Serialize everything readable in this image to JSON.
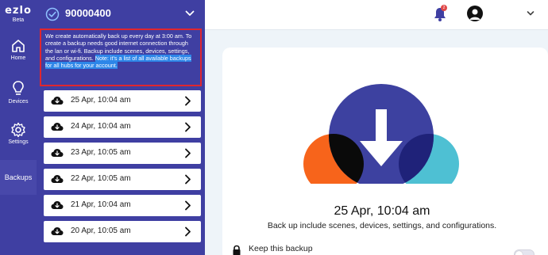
{
  "app": {
    "logo_text": "ezlo",
    "logo_badge": "Beta"
  },
  "nav": {
    "items": [
      {
        "label": "Home",
        "icon": "home-icon"
      },
      {
        "label": "Devices",
        "icon": "lightbulb-icon"
      },
      {
        "label": "Settings",
        "icon": "gear-icon"
      }
    ],
    "active": {
      "label": "Backups"
    }
  },
  "hub": {
    "id": "90000400",
    "status_icon": "check-circle-icon"
  },
  "info": {
    "text": "We create automatically back up every day at 3:00 am. To create a backup needs good internet connection through the lan or wi-fi. Backup include scenes, devices, settings, and configurations.",
    "note": "Note: it's a list of all available backups for all hubs for your account."
  },
  "backups": [
    {
      "date": "25 Apr, 10:04 am"
    },
    {
      "date": "24 Apr, 10:04 am"
    },
    {
      "date": "23 Apr, 10:05 am"
    },
    {
      "date": "22 Apr, 10:05 am"
    },
    {
      "date": "21 Apr, 10:04 am"
    },
    {
      "date": "20 Apr, 10:05 am"
    }
  ],
  "topbar": {
    "notification_count": "2"
  },
  "detail": {
    "date": "25 Apr, 10:04 am",
    "description": "Back up include scenes, devices, settings, and configurations.",
    "keep_label": "Keep this backup",
    "keep_enabled": false
  },
  "colors": {
    "sidebar": "#3f3fa2",
    "highlight_border": "#e0262e",
    "note_highlight": "#2d86e8",
    "cloud_orange": "#f7641b",
    "cloud_blue": "#3d41a0",
    "cloud_cyan": "#4ec0d3"
  }
}
